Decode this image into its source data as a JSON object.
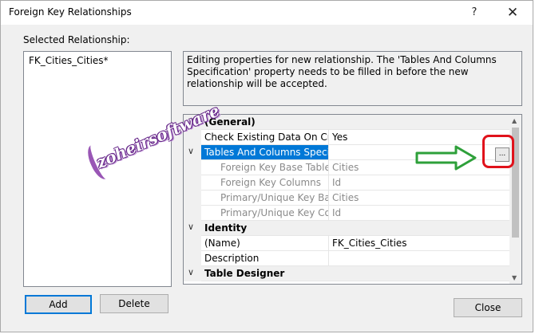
{
  "window": {
    "title": "Foreign Key Relationships",
    "help": "?",
    "close": "✕"
  },
  "selected_label": "Selected Relationship:",
  "relationships": [
    "FK_Cities_Cities*"
  ],
  "description": "Editing properties for new relationship.  The 'Tables And Columns Specification' property needs to be filled in before the new relationship will be accepted.",
  "grid": {
    "general": {
      "label": "(General)",
      "check_existing_name": "Check Existing Data On Creat",
      "check_existing_value": "Yes",
      "tables_columns_name": "Tables And Columns Specifica",
      "fk_base_table_name": "Foreign Key Base Table",
      "fk_base_table_value": "Cities",
      "fk_columns_name": "Foreign Key Columns",
      "fk_columns_value": "Id",
      "pk_base_name": "Primary/Unique Key Base",
      "pk_base_value": "Cities",
      "pk_columns_name": "Primary/Unique Key Colu",
      "pk_columns_value": "Id"
    },
    "identity": {
      "label": "Identity",
      "name_label": "(Name)",
      "name_value": "FK_Cities_Cities",
      "description_label": "Description",
      "description_value": ""
    },
    "table_designer": {
      "label": "Table Designer"
    },
    "ellipsis": "..."
  },
  "buttons": {
    "add": "Add",
    "delete": "Delete",
    "close": "Close"
  },
  "watermark": "zoheirsoftware",
  "colors": {
    "selection": "#0078d7",
    "highlight_box": "#e0121b",
    "arrow": "#2ea03a"
  }
}
